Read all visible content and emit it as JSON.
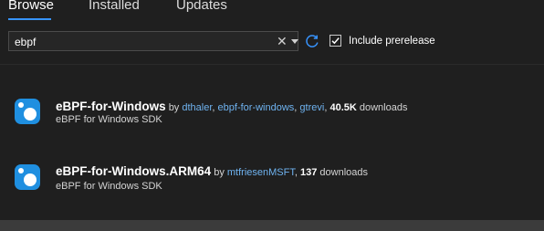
{
  "tabs": [
    {
      "label": "Browse"
    },
    {
      "label": "Installed"
    },
    {
      "label": "Updates"
    }
  ],
  "search": {
    "value": "ebpf",
    "clear_icon": "close-icon",
    "dropdown_icon": "chevron-down-icon",
    "refresh_icon": "refresh-icon"
  },
  "prerelease": {
    "label": "Include prerelease",
    "checked": true
  },
  "packages": [
    {
      "name": "eBPF-for-Windows",
      "by": "by",
      "authors": [
        "dthaler",
        "ebpf-for-windows",
        "gtrevi"
      ],
      "downloads": "40.5K",
      "downloads_label": "downloads",
      "description": "eBPF for Windows SDK"
    },
    {
      "name": "eBPF-for-Windows.ARM64",
      "by": "by",
      "authors": [
        "mtfriesenMSFT"
      ],
      "downloads": "137",
      "downloads_label": "downloads",
      "description": "eBPF for Windows SDK"
    }
  ],
  "colors": {
    "accent": "#3794ff",
    "link": "#6fb3f0",
    "background": "#1f1f1f",
    "icon_blue": "#1f8fe0"
  }
}
